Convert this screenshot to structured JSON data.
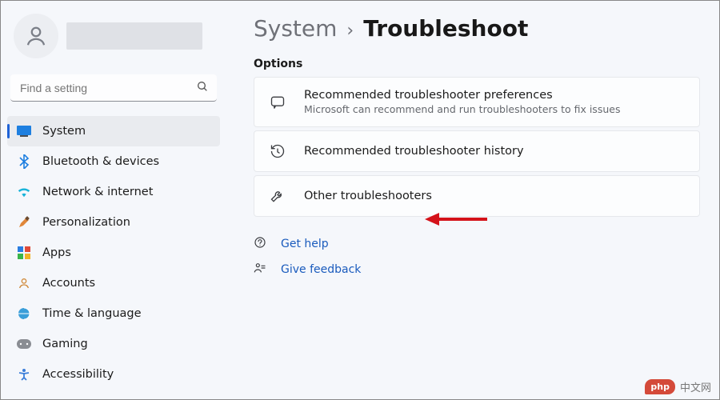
{
  "search": {
    "placeholder": "Find a setting"
  },
  "sidebar": {
    "items": [
      {
        "label": "System"
      },
      {
        "label": "Bluetooth & devices"
      },
      {
        "label": "Network & internet"
      },
      {
        "label": "Personalization"
      },
      {
        "label": "Apps"
      },
      {
        "label": "Accounts"
      },
      {
        "label": "Time & language"
      },
      {
        "label": "Gaming"
      },
      {
        "label": "Accessibility"
      }
    ]
  },
  "breadcrumb": {
    "parent": "System",
    "current": "Troubleshoot"
  },
  "section": {
    "label": "Options"
  },
  "cards": [
    {
      "title": "Recommended troubleshooter preferences",
      "sub": "Microsoft can recommend and run troubleshooters to fix issues"
    },
    {
      "title": "Recommended troubleshooter history"
    },
    {
      "title": "Other troubleshooters"
    }
  ],
  "links": {
    "help": "Get help",
    "feedback": "Give feedback"
  },
  "watermark": {
    "badge": "php",
    "text": "中文网"
  }
}
